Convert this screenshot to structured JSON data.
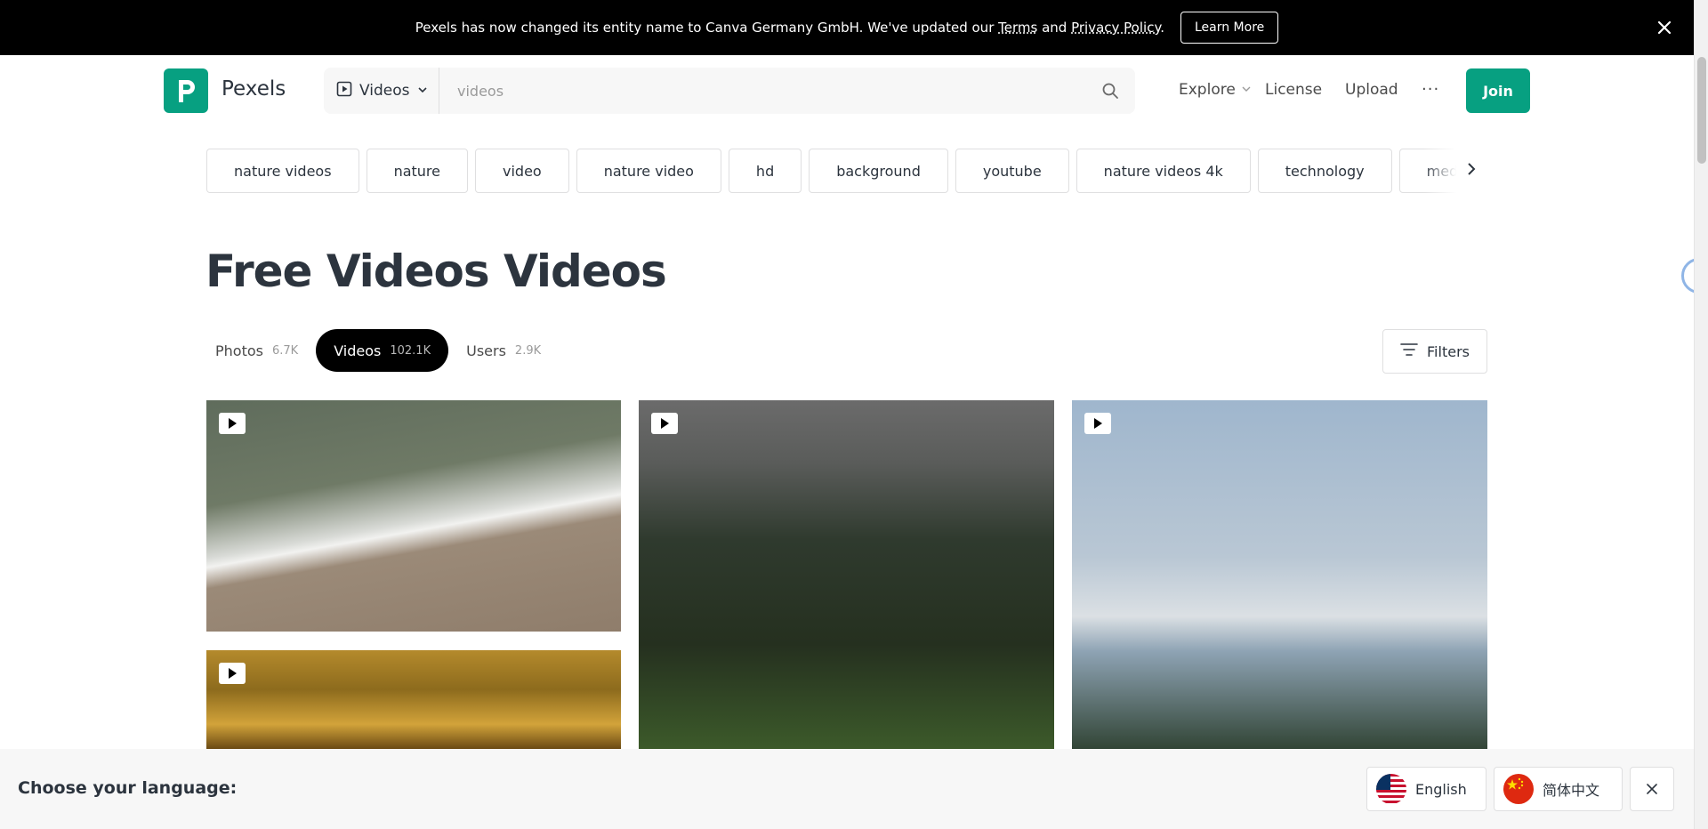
{
  "announcement": {
    "text_before": "Pexels has now changed its entity name to Canva Germany GmbH. We've updated our ",
    "terms_link": "Terms",
    "and_text": " and ",
    "privacy_link": "Privacy Policy",
    "period": ".",
    "learn_more": "Learn More"
  },
  "header": {
    "logo_text": "Pexels",
    "search_type": "Videos",
    "search_placeholder": "videos",
    "nav": {
      "explore": "Explore",
      "license": "License",
      "upload": "Upload",
      "more": "···",
      "join": "Join"
    }
  },
  "chips": [
    "nature videos",
    "nature",
    "video",
    "nature video",
    "hd",
    "background",
    "youtube",
    "nature videos 4k",
    "technology",
    "meditation"
  ],
  "page": {
    "title": "Free Videos Videos",
    "tabs": [
      {
        "label": "Photos",
        "count": "6.7K"
      },
      {
        "label": "Videos",
        "count": "102.1K"
      },
      {
        "label": "Users",
        "count": "2.9K"
      }
    ],
    "filters": "Filters"
  },
  "language_bar": {
    "label": "Choose your language:",
    "english": "English",
    "chinese": "简体中文"
  },
  "colors": {
    "brand": "#07a081",
    "text": "#2c343e",
    "announcement_bg": "#000000"
  }
}
